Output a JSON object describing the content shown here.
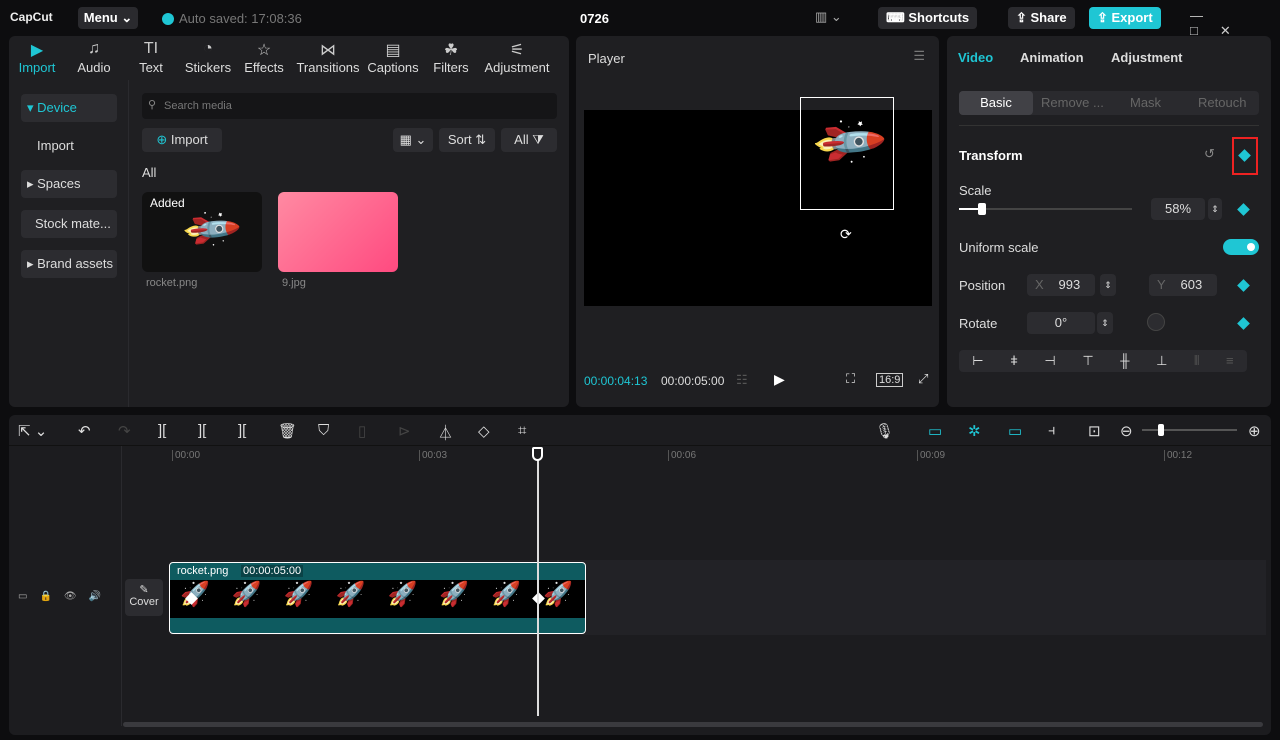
{
  "app": {
    "logo": "CapCut",
    "menu": "Menu",
    "autosave": "Auto saved: 17:08:36",
    "project": "0726",
    "shortcuts": "Shortcuts",
    "share": "Share",
    "export": "Export"
  },
  "toolbar_tabs": [
    {
      "label": "Import",
      "icon": "TV"
    },
    {
      "label": "Audio",
      "icon": "♫"
    },
    {
      "label": "Text",
      "icon": "TI"
    },
    {
      "label": "Stickers",
      "icon": "◔"
    },
    {
      "label": "Effects",
      "icon": "☆"
    },
    {
      "label": "Transitions",
      "icon": "⋈"
    },
    {
      "label": "Captions",
      "icon": "▤"
    },
    {
      "label": "Filters",
      "icon": "☘"
    },
    {
      "label": "Adjustment",
      "icon": "⚟"
    }
  ],
  "sidebar": {
    "items": [
      "▾ Device",
      "Import",
      "▸ Spaces",
      "Stock mate...",
      "▸ Brand assets"
    ]
  },
  "media": {
    "search_placeholder": "Search media",
    "import": "Import",
    "sort": "Sort",
    "all_filter": "All",
    "section": "All",
    "items": [
      {
        "name": "rocket.png",
        "badge": "Added"
      },
      {
        "name": "9.jpg"
      }
    ]
  },
  "player": {
    "title": "Player",
    "current_time": "00:00:04:13",
    "duration": "00:00:05:00",
    "ratio": "16:9"
  },
  "inspector": {
    "tabs": [
      "Video",
      "Animation",
      "Adjustment"
    ],
    "subtabs": [
      "Basic",
      "Remove ...",
      "Mask",
      "Retouch"
    ],
    "section": "Transform",
    "scale_label": "Scale",
    "scale_value": "58%",
    "scale_percent": 58,
    "uniform_label": "Uniform scale",
    "uniform_on": true,
    "position_label": "Position",
    "x_label": "X",
    "x": "993",
    "y_label": "Y",
    "y": "603",
    "rotate_label": "Rotate",
    "rotate": "0°",
    "accent": "#1fc6d4"
  },
  "timeline": {
    "ticks": [
      "00:00",
      "00:03",
      "00:06",
      "00:09",
      "00:12"
    ],
    "clip_name": "rocket.png",
    "clip_duration": "00:00:05:00",
    "cover": "Cover"
  }
}
